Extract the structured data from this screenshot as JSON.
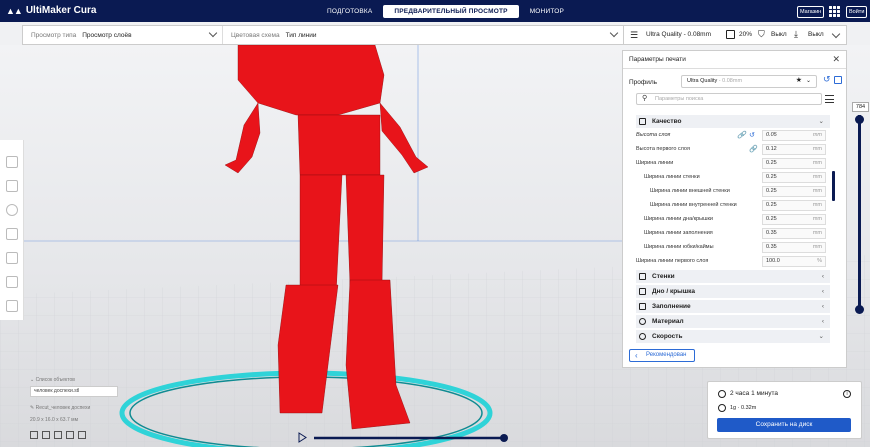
{
  "app": {
    "title": "UltiMaker Cura"
  },
  "stages": [
    {
      "label": "ПОДГОТОВКА",
      "active": false
    },
    {
      "label": "ПРЕДВАРИТЕЛЬНЫЙ ПРОСМОТР",
      "active": true
    },
    {
      "label": "МОНИТОР",
      "active": false
    }
  ],
  "header": {
    "marketplace": "Магазин",
    "signin": "Войти"
  },
  "view": {
    "type_label": "Просмотр типа",
    "type_value": "Просмотр слоёв",
    "scheme_label": "Цветовая схема",
    "scheme_value": "Тип линии"
  },
  "print_bar": {
    "profile": "Ultra Quality - 0.08mm",
    "infill": "20%",
    "support": "Выкл",
    "adhesion": "Выкл"
  },
  "panel": {
    "title": "Параметры печати",
    "profile_label": "Профиль",
    "profile_value": "Ultra Quality",
    "profile_sub": "- 0.08mm",
    "search_placeholder": "Параметры поиска",
    "categories": [
      "Качество",
      "Стенки",
      "Дно / крышка",
      "Заполнение",
      "Материал",
      "Скорость"
    ],
    "settings": [
      {
        "label": "Высота слоя",
        "value": "0.05",
        "unit": "mm"
      },
      {
        "label": "Высота первого слоя",
        "value": "0.12",
        "unit": "mm"
      },
      {
        "label": "Ширина линии",
        "value": "0.25",
        "unit": "mm"
      },
      {
        "label": "Ширина линии стенки",
        "value": "0.25",
        "unit": "mm"
      },
      {
        "label": "Ширина линии внешней стенки",
        "value": "0.25",
        "unit": "mm"
      },
      {
        "label": "Ширина линии внутренней стенки",
        "value": "0.25",
        "unit": "mm"
      },
      {
        "label": "Ширина линии дна/крышки",
        "value": "0.25",
        "unit": "mm"
      },
      {
        "label": "Ширина линии заполнения",
        "value": "0.35",
        "unit": "mm"
      },
      {
        "label": "Ширина линии юбки/каймы",
        "value": "0.35",
        "unit": "mm"
      },
      {
        "label": "Ширина линии первого слоя",
        "value": "100.0",
        "unit": "%"
      }
    ],
    "recommended": "Рекомендован"
  },
  "layer": {
    "current": "784"
  },
  "objects": {
    "header": "Список объектов",
    "filename": "человек доспехи.stl",
    "item": "Recut_человек доспехи",
    "dims": "20.9 x 16.0 x 63.7 мм"
  },
  "action": {
    "time": "2 часа 1 минута",
    "material": "1g · 0.32m",
    "save": "Сохранить на диск"
  },
  "colors": {
    "topbar": "#0a1a52",
    "accent": "#1f5ac8",
    "model": "#e8141a",
    "ring": "#2fd3d8"
  }
}
